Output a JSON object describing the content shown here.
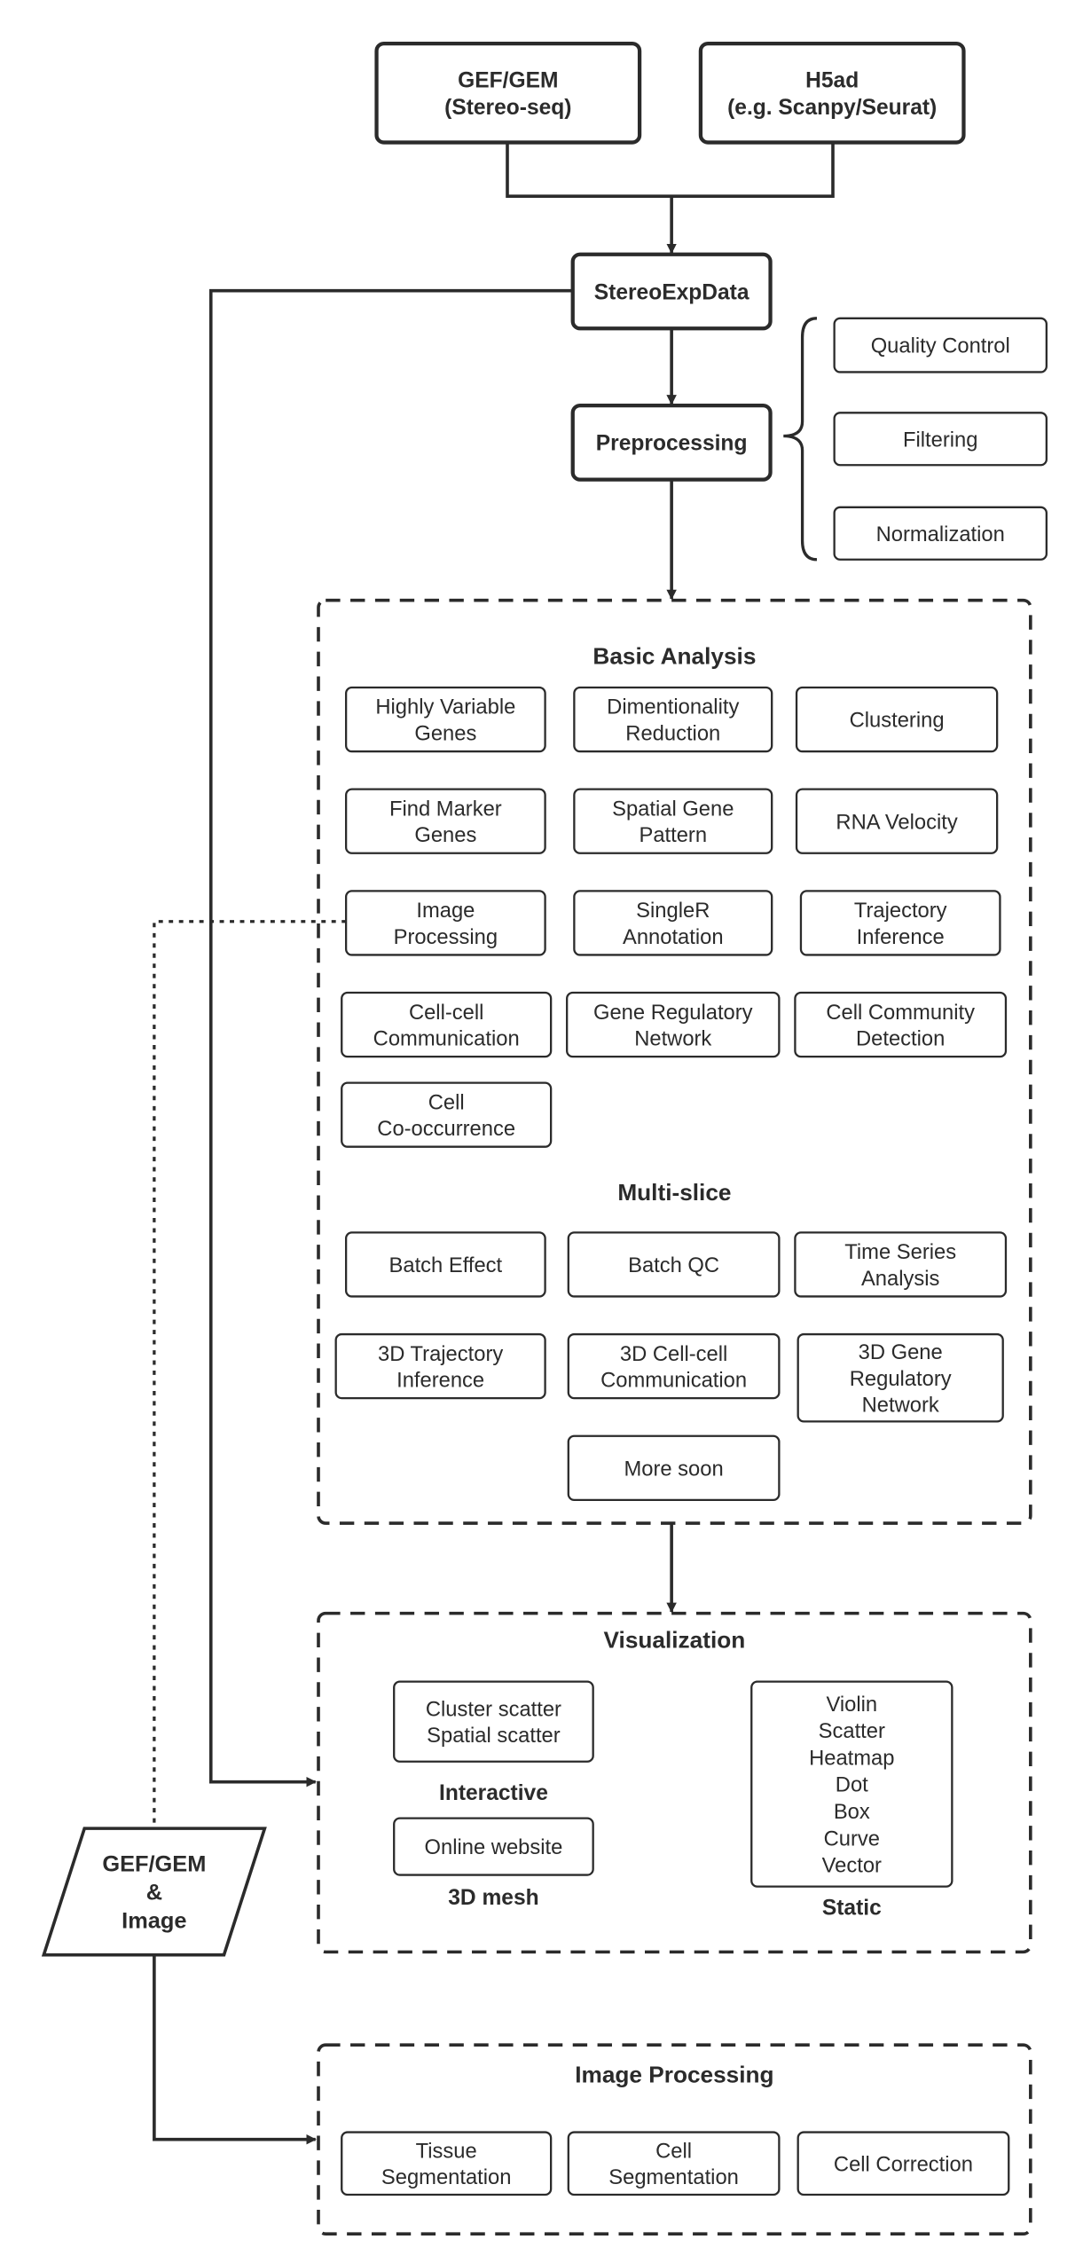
{
  "inputs": {
    "gef_gem": [
      "GEF/GEM",
      "(Stereo-seq)"
    ],
    "h5ad": [
      "H5ad",
      "(e.g. Scanpy/Seurat)"
    ]
  },
  "core": {
    "stereo_exp_data": [
      "StereoExpData"
    ],
    "preprocessing": [
      "Preprocessing"
    ]
  },
  "preprocessing_steps": [
    [
      "Quality Control"
    ],
    [
      "Filtering"
    ],
    [
      "Normalization"
    ]
  ],
  "basic_analysis": {
    "title": [
      "Basic Analysis"
    ],
    "items": [
      [
        "Highly Variable",
        "Genes"
      ],
      [
        "Dimentionality",
        "Reduction"
      ],
      [
        "Clustering"
      ],
      [
        "Find Marker",
        "Genes"
      ],
      [
        "Spatial Gene",
        "Pattern"
      ],
      [
        "RNA Velocity"
      ],
      [
        "Image",
        "Processing"
      ],
      [
        "SingleR",
        "Annotation"
      ],
      [
        "Trajectory",
        "Inference"
      ],
      [
        "Cell-cell",
        "Communication"
      ],
      [
        "Gene Regulatory",
        "Network"
      ],
      [
        "Cell Community",
        "Detection"
      ],
      [
        "Cell",
        "Co-occurrence"
      ]
    ]
  },
  "multi_slice": {
    "title": [
      "Multi-slice"
    ],
    "items": [
      [
        "Batch Effect"
      ],
      [
        "Batch QC"
      ],
      [
        "Time Series",
        "Analysis"
      ],
      [
        "3D Trajectory",
        "Inference"
      ],
      [
        "3D Cell-cell",
        "Communication"
      ],
      [
        "3D Gene",
        "Regulatory",
        "Network"
      ],
      [
        "More soon"
      ]
    ]
  },
  "visualization": {
    "title": [
      "Visualization"
    ],
    "interactive_box": [
      "Cluster scatter",
      "Spatial scatter"
    ],
    "interactive_label": [
      "Interactive"
    ],
    "mesh_box": [
      "Online website"
    ],
    "mesh_label": [
      "3D mesh"
    ],
    "static_box": [
      "Violin",
      "Scatter",
      "Heatmap",
      "Dot",
      "Box",
      "Curve",
      "Vector"
    ],
    "static_label": [
      "Static"
    ]
  },
  "image_input": [
    "GEF/GEM",
    "&",
    "Image"
  ],
  "image_processing": {
    "title": [
      "Image Processing"
    ],
    "items": [
      [
        "Tissue",
        "Segmentation"
      ],
      [
        "Cell",
        "Segmentation"
      ],
      [
        "Cell Correction"
      ]
    ]
  },
  "colors": {
    "stroke": "#2b2b2b",
    "background": "#ffffff"
  }
}
